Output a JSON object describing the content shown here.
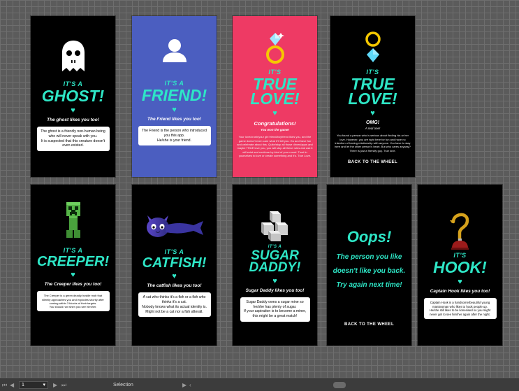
{
  "cards": {
    "ghost": {
      "its": "IT'S A",
      "title": "GHOST!",
      "tagline": "The ghost likes you too!",
      "desc": [
        "The ghost is a friendly non-human being who will never speak with you.",
        "It is suspected that this creature doesn't even existed."
      ]
    },
    "friend": {
      "its": "IT'S A",
      "title": "FRIEND!",
      "tagline": "The Friend likes you too!",
      "desc": [
        "The Friend is the person who introduced you this app.",
        "He/she is your friend."
      ]
    },
    "truelove1": {
      "its": "IT'S",
      "title1": "TRUE",
      "title2": "LOVE!",
      "tagline": "Congratulations!",
      "sub": "You won the game!",
      "small": "Your love/crush/your girl friend/boyfriend likes you, and the game doesn't even care what it'll tell you. Go and have fun and celebrate about this. Quite/stop all those drives/apps and maybe TRUE love you, you will stop all these rules and ask it will exist and continue by kind of your mood. Trust in yourselves to love or create something and it's. True Love."
    },
    "truelove2": {
      "its": "IT'S",
      "title1": "TRUE",
      "title2": "LOVE!",
      "tagline": "OMG!",
      "sub": "A real one!",
      "small": "You found a person who is serious about finding his or her love. However, you are right here for fun and have no intention of having relationship with anyone. You have to stay here and let the other person's heart. But who cares anyway? There is just a friendly guy. True love.",
      "link": "BACK TO THE WHEEL"
    },
    "creeper": {
      "its": "IT'S A",
      "title": "CREEPER!",
      "tagline": "The Creeper likes you too!",
      "desc": [
        "The Creeper is a green deadly hostile mob that silently approaches you and explodes shortly after coming within 3 blocks of their targets.",
        "You should run when you see him/her."
      ]
    },
    "catfish": {
      "its": "IT'S A",
      "title": "CATFISH!",
      "tagline": "The catfish likes you too!",
      "desc": [
        "A cat who thinks it's a fish or a fish who thinks it's a cat.",
        "Nobody knows what its actual identity is.",
        "Might not be a cat nor a fish afterall."
      ]
    },
    "sugardaddy": {
      "its": "IT'S A",
      "title1": "SUGAR",
      "title2": "DADDY!",
      "tagline": "Sugar Daddy likes you too!",
      "desc": [
        "Sugar Daddy owns a sugar mine so he/she has plenty of sugar.",
        "If your aspiration is to become a miner, this might be a great match!"
      ]
    },
    "oops": {
      "title": "Oops!",
      "line1": "The person you like",
      "line2": "doesn't like you back.",
      "line3": "Try again next time!",
      "link": "BACK TO THE WHEEL"
    },
    "hook": {
      "its": "IT'S",
      "title": "HOOK!",
      "tagline": "Captain Hook likes you too!",
      "desc": [
        "Captain Hook is a handsome/beautiful young man/woman who likes to hook people up.",
        "He/she still likes to be lionesised so you might never get to see him/her again after the night."
      ]
    }
  },
  "statusbar": {
    "page": "1",
    "status": "Selection"
  },
  "colors": {
    "accent": "#2ee6c6",
    "friend_bg": "#4b5ec0",
    "truelove_bg": "#ee3a64",
    "card_bg": "#000000"
  }
}
